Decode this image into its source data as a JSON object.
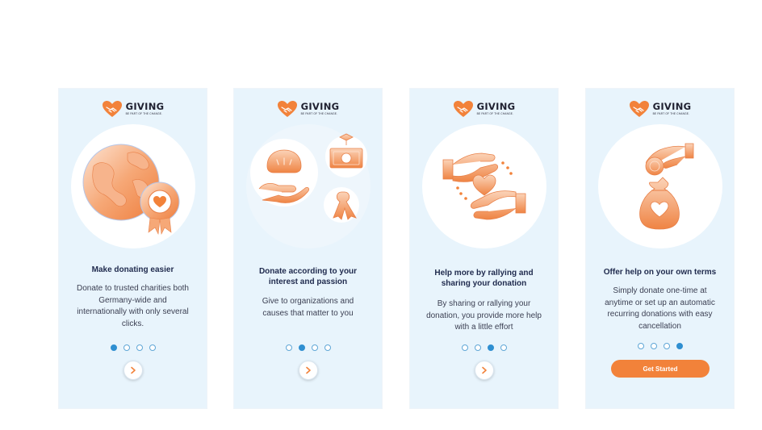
{
  "brand": {
    "name": "GIVING",
    "tagline": "BE PART OF THE CHANGE.",
    "accent_color": "#f2823a",
    "secondary_color": "#2f8fd1",
    "background_color": "#e8f4fc"
  },
  "screens": [
    {
      "title": "Make donating easier",
      "body": "Donate to trusted charities both Germany-wide and internationally with only several clicks.",
      "illustration_icon": "globe-with-heart-badge-icon",
      "active_dot": 1,
      "action_icon": "chevron-right-icon"
    },
    {
      "title": "Donate according to your interest and passion",
      "body": "Give to organizations and causes that matter to you",
      "illustration_icon": "interest-categories-icon",
      "active_dot": 2,
      "action_icon": "chevron-right-icon"
    },
    {
      "title": "Help more by rallying and sharing your donation",
      "body": "By sharing or rallying your donation, you provide more help with a little effort",
      "illustration_icon": "hands-sharing-heart-icon",
      "active_dot": 3,
      "action_icon": "chevron-right-icon"
    },
    {
      "title": "Offer help on your own terms",
      "body": "Simply donate one-time at anytime or set up an automatic recurring donations with easy cancellation",
      "illustration_icon": "hand-coin-money-bag-icon",
      "active_dot": 4,
      "action_label": "Get Started"
    }
  ]
}
